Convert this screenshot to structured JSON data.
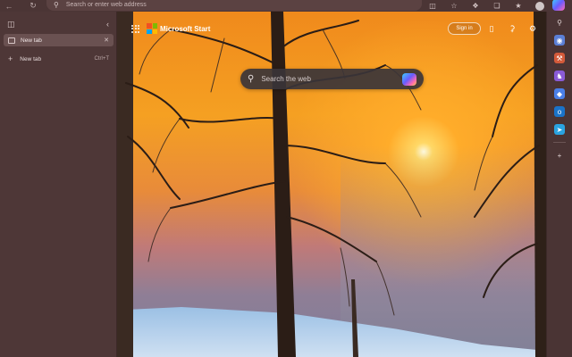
{
  "address_bar": {
    "placeholder": "Search or enter web address"
  },
  "vertical_tabs": {
    "active_tab": {
      "label": "New tab"
    },
    "new_tab": {
      "label": "New tab",
      "shortcut": "Ctrl+T"
    }
  },
  "page": {
    "brand": "Microsoft Start",
    "signin_label": "Sign in",
    "search_placeholder": "Search the web"
  },
  "colors": {
    "chrome": "#4a3434",
    "sidebar": "#4e3737",
    "active_tab": "#6a5151"
  },
  "icons": {
    "toolbar_left": [
      "back-icon",
      "refresh-icon"
    ],
    "toolbar_right": [
      "reading-view-icon",
      "favorite-star-icon",
      "extensions-icon",
      "collections-icon",
      "favorites-icon",
      "profile-avatar",
      "more-icon"
    ],
    "rail": [
      "search-icon",
      "shopping-icon",
      "tools-icon",
      "games-icon",
      "microsoft365-icon",
      "outlook-icon",
      "telegram-icon",
      "add-icon"
    ]
  }
}
